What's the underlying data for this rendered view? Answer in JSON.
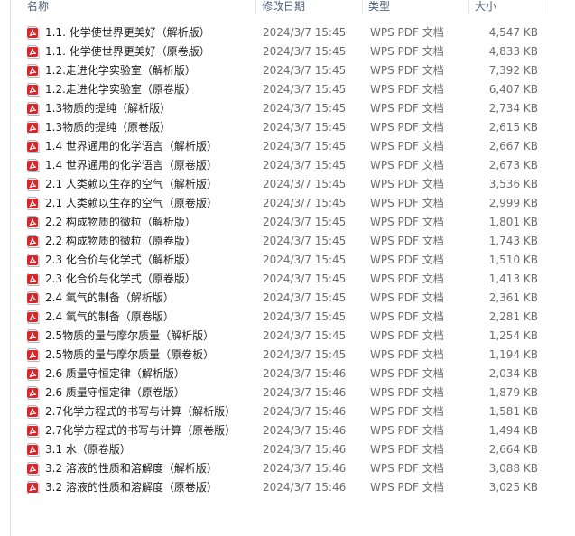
{
  "columns": {
    "name": "名称",
    "date": "修改日期",
    "type": "类型",
    "size": "大小"
  },
  "files": [
    {
      "name": "1.1. 化学使世界更美好（解析版）",
      "date": "2024/3/7 15:45",
      "type": "WPS PDF 文档",
      "size": "4,547 KB"
    },
    {
      "name": "1.1. 化学使世界更美好（原卷版）",
      "date": "2024/3/7 15:45",
      "type": "WPS PDF 文档",
      "size": "4,833 KB"
    },
    {
      "name": "1.2.走进化学实验室（解析版）",
      "date": "2024/3/7 15:45",
      "type": "WPS PDF 文档",
      "size": "7,392 KB"
    },
    {
      "name": "1.2.走进化学实验室（原卷版）",
      "date": "2024/3/7 15:45",
      "type": "WPS PDF 文档",
      "size": "6,407 KB"
    },
    {
      "name": "1.3物质的提纯（解析版）",
      "date": "2024/3/7 15:45",
      "type": "WPS PDF 文档",
      "size": "2,734 KB"
    },
    {
      "name": "1.3物质的提纯（原卷版）",
      "date": "2024/3/7 15:45",
      "type": "WPS PDF 文档",
      "size": "2,615 KB"
    },
    {
      "name": "1.4  世界通用的化学语言（解析版）",
      "date": "2024/3/7 15:45",
      "type": "WPS PDF 文档",
      "size": "2,667 KB"
    },
    {
      "name": "1.4 世界通用的化学语言（原卷版）",
      "date": "2024/3/7 15:45",
      "type": "WPS PDF 文档",
      "size": "2,673 KB"
    },
    {
      "name": "2.1  人类赖以生存的空气（解析版）",
      "date": "2024/3/7 15:45",
      "type": "WPS PDF 文档",
      "size": "3,536 KB"
    },
    {
      "name": "2.1  人类赖以生存的空气（原卷版）",
      "date": "2024/3/7 15:45",
      "type": "WPS PDF 文档",
      "size": "2,999 KB"
    },
    {
      "name": "2.2  构成物质的微粒（解析版）",
      "date": "2024/3/7 15:45",
      "type": "WPS PDF 文档",
      "size": "1,801 KB"
    },
    {
      "name": "2.2  构成物质的微粒（原卷版）",
      "date": "2024/3/7 15:45",
      "type": "WPS PDF 文档",
      "size": "1,743 KB"
    },
    {
      "name": "2.3 化合价与化学式（解析版）",
      "date": "2024/3/7 15:45",
      "type": "WPS PDF 文档",
      "size": "1,510 KB"
    },
    {
      "name": "2.3 化合价与化学式（原卷版）",
      "date": "2024/3/7 15:45",
      "type": "WPS PDF 文档",
      "size": "1,413 KB"
    },
    {
      "name": "2.4 氧气的制备（解析版）",
      "date": "2024/3/7 15:45",
      "type": "WPS PDF 文档",
      "size": "2,361 KB"
    },
    {
      "name": "2.4 氧气的制备（原卷版）",
      "date": "2024/3/7 15:45",
      "type": "WPS PDF 文档",
      "size": "2,281 KB"
    },
    {
      "name": "2.5物质的量与摩尔质量（解析版）",
      "date": "2024/3/7 15:45",
      "type": "WPS PDF 文档",
      "size": "1,254 KB"
    },
    {
      "name": "2.5物质的量与摩尔质量（原卷板）",
      "date": "2024/3/7 15:45",
      "type": "WPS PDF 文档",
      "size": "1,194 KB"
    },
    {
      "name": "2.6 质量守恒定律（解析版）",
      "date": "2024/3/7 15:46",
      "type": "WPS PDF 文档",
      "size": "2,034 KB"
    },
    {
      "name": "2.6 质量守恒定律（原卷版）",
      "date": "2024/3/7 15:46",
      "type": "WPS PDF 文档",
      "size": "1,879 KB"
    },
    {
      "name": "2.7化学方程式的书写与计算（解析版）",
      "date": "2024/3/7 15:46",
      "type": "WPS PDF 文档",
      "size": "1,581 KB"
    },
    {
      "name": "2.7化学方程式的书写与计算（原卷版）",
      "date": "2024/3/7 15:46",
      "type": "WPS PDF 文档",
      "size": "1,494 KB"
    },
    {
      "name": "3.1 水（原卷版）",
      "date": "2024/3/7 15:46",
      "type": "WPS PDF 文档",
      "size": "2,664 KB"
    },
    {
      "name": "3.2 溶液的性质和溶解度（解析版）",
      "date": "2024/3/7 15:46",
      "type": "WPS PDF 文档",
      "size": "3,088 KB"
    },
    {
      "name": "3.2 溶液的性质和溶解度（原卷版）",
      "date": "2024/3/7 15:46",
      "type": "WPS PDF 文档",
      "size": "3,025 KB"
    }
  ],
  "icon": "pdf-file-icon",
  "colors": {
    "pdf_icon": "#d9262b",
    "name_text": "#1e1e1e",
    "meta_text": "#6d6d6d",
    "header_text": "#4c607a"
  }
}
